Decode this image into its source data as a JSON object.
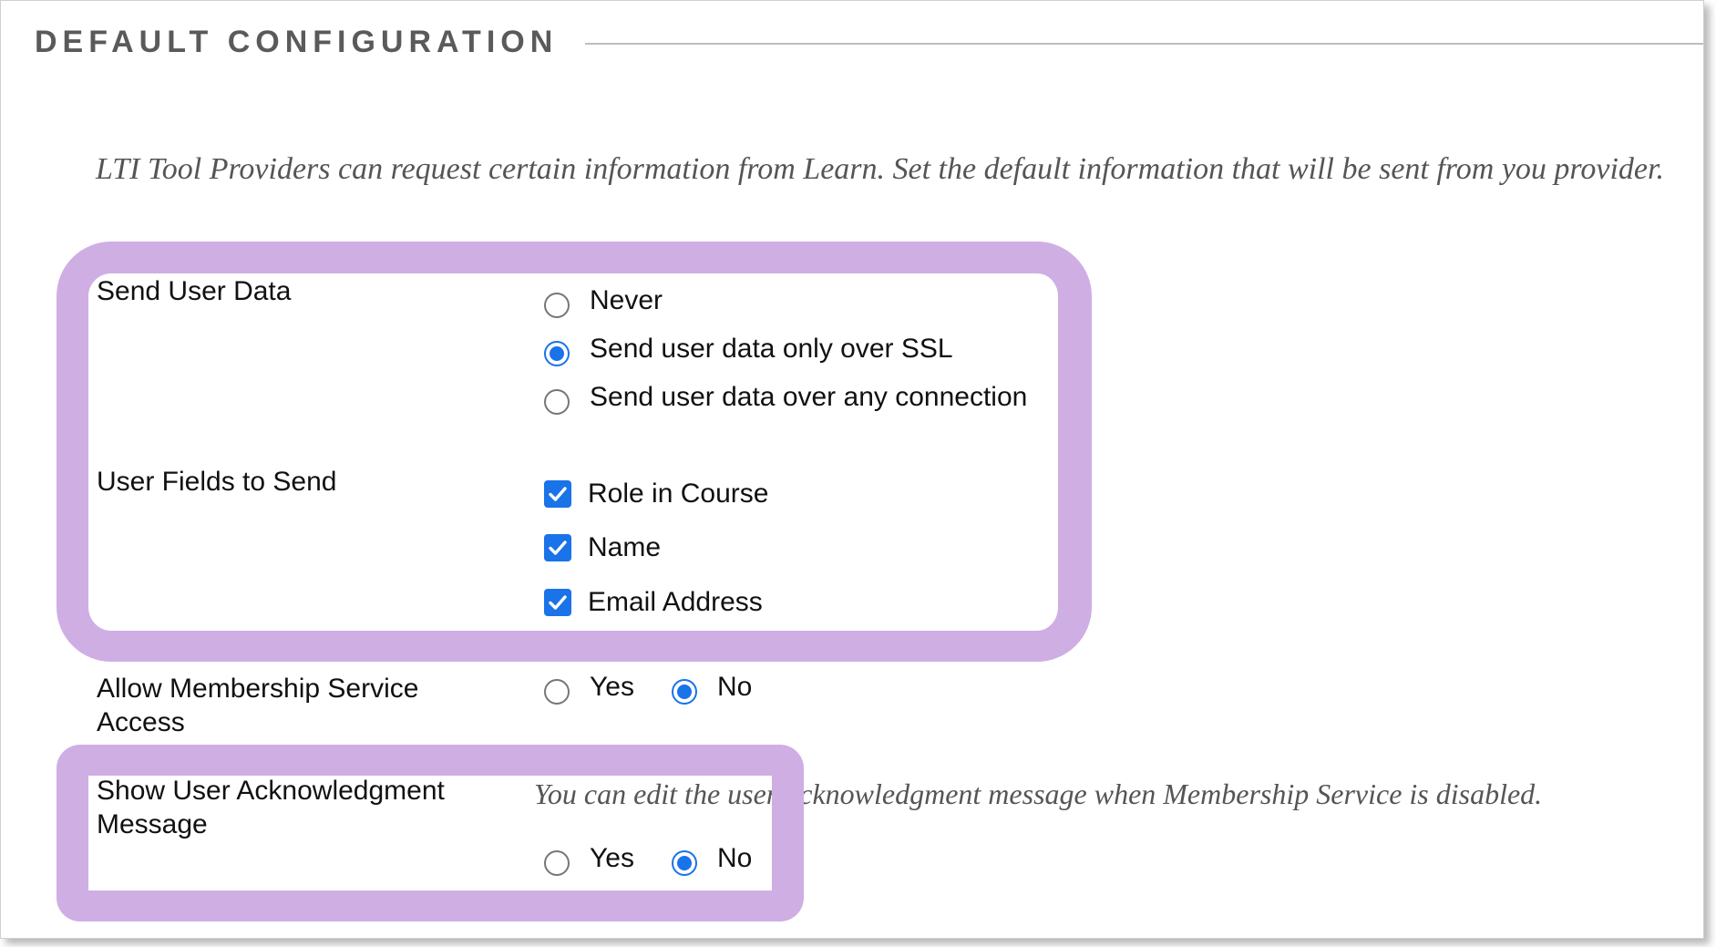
{
  "section": {
    "title": "DEFAULT CONFIGURATION"
  },
  "intro": {
    "text": "LTI Tool Providers can request certain information from Learn. Set the default information that will be sent from you provider."
  },
  "send_user_data": {
    "label": "Send User Data",
    "options": [
      {
        "label": "Never",
        "selected": false
      },
      {
        "label": "Send user data only over SSL",
        "selected": true
      },
      {
        "label": "Send user data over any connection",
        "selected": false
      }
    ]
  },
  "user_fields": {
    "label": "User Fields to Send",
    "options": [
      {
        "label": "Role in Course",
        "checked": true
      },
      {
        "label": "Name",
        "checked": true
      },
      {
        "label": "Email Address",
        "checked": true
      }
    ]
  },
  "membership_service": {
    "label": "Allow Membership Service Access",
    "yes_label": "Yes",
    "no_label": "No",
    "selected": "No"
  },
  "acknowledgment": {
    "label": "Show User Acknowledgment Message",
    "hint": "You can edit the user acknowledgment message when Membership Service is disabled.",
    "yes_label": "Yes",
    "no_label": "No",
    "selected": "No"
  },
  "colors": {
    "highlight": "#cfaee4",
    "accent": "#1a73e8",
    "section_title": "#5a5a5a"
  }
}
